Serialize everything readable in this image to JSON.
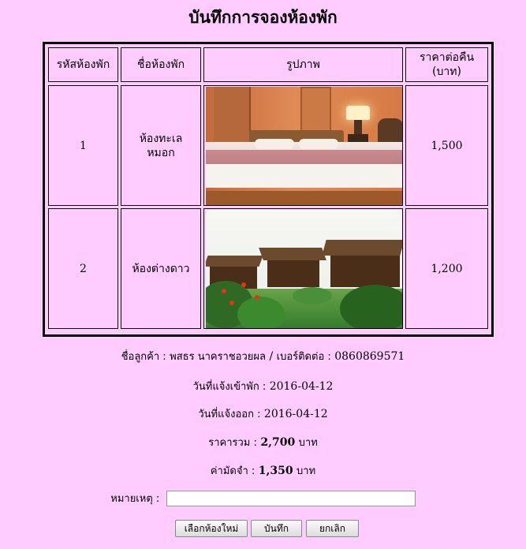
{
  "page": {
    "title": "บันทึกการจองห้องพัก"
  },
  "table": {
    "headers": [
      "รหัสห้องพัก",
      "ชื่อห้องพัก",
      "รูปภาพ",
      "ราคาต่อคืน (บาท)"
    ],
    "rows": [
      {
        "id": "1",
        "name": "ห้องทะเล หมอก",
        "image": "bedroom-photo",
        "price": "1,500"
      },
      {
        "id": "2",
        "name": "ห้องต่างดาว",
        "image": "bungalow-garden-photo",
        "price": "1,200"
      }
    ]
  },
  "summary": {
    "customer_label": "ชื่อลูกค้า :",
    "customer_name": "พสธร นาคราชอวยผล",
    "separator": "/",
    "phone_label": "เบอร์ติดต่อ :",
    "phone": "0860869571",
    "checkin_label": "วันที่แจ้งเข้าพัก :",
    "checkin": "2016-04-12",
    "checkout_label": "วันที่แจ้งออก :",
    "checkout": "2016-04-12",
    "total_label": "ราคารวม :",
    "total": "2,700",
    "total_unit": "บาท",
    "deposit_label": "ค่ามัดจำ :",
    "deposit": "1,350",
    "deposit_unit": "บาท",
    "remark_label": "หมายเหตุ :",
    "remark_value": ""
  },
  "buttons": {
    "select_new_room": "เลือกห้องใหม่",
    "save": "บันทึก",
    "cancel": "ยกเลิก"
  }
}
